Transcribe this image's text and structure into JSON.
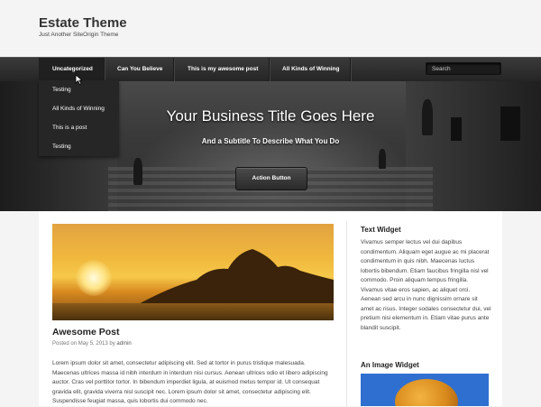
{
  "site": {
    "title": "Estate Theme",
    "tagline": "Just Another SiteOrigin Theme"
  },
  "nav": {
    "items": [
      "Uncategorized",
      "Can You Believe",
      "This is my awesome post",
      "All Kinds of Winning"
    ],
    "search_placeholder": "Search"
  },
  "dropdown": {
    "items": [
      "Testing",
      "All Kinds of Winning",
      "This is a post",
      "Testing"
    ]
  },
  "hero": {
    "title": "Your Business Title Goes Here",
    "subtitle": "And a Subtitle To Describe What You Do",
    "button": "Action Button"
  },
  "post": {
    "title": "Awesome Post",
    "meta_prefix": "Posted on",
    "date": "May 5, 2013",
    "meta_by": "by",
    "author": "admin",
    "excerpt": "Lorem ipsum dolor sit amet, consectetur adipiscing elit. Sed at tortor in purus tristique malesuada. Maecenas ultrices massa id nibh interdum in interdum nisi cursus. Aenean ultrices odio et libero adipiscing auctor. Cras vel porttitor tortor. In bibendum imperdiet ligula, at euismod metus tempor id. Ut consequat gravida elit, gravida viverra nisl suscipit nec. Lorem ipsum dolor sit amet, consectetur adipiscing elit. Suspendisse feugiat massa, quis lobortis dui commodo nec."
  },
  "sidebar": {
    "text_widget_title": "Text Widget",
    "text_widget_body": "Vivamus semper lectus vel dui dapibus condimentum. Aliquam eget augue ac mi placerat condimentum in quis nibh. Maecenas luctus lobortis bibendum. Etiam faucibus fringilla nisl vel commodo. Proin aliquam tempus fringilla. Vivamus vitae eros sapien, ac aliquet orci. Aenean sed arcu in nunc dignissim ornare sit amet ac risus. Integer sodales consectetur dui, vel pretium nisi elementum in. Etiam vitae purus ante blandit suscipit.",
    "image_widget_title": "An Image Widget"
  },
  "colors": {
    "nav_bg": "#2b2b2b",
    "dropdown_bg": "#262626",
    "page_bg": "#f4f4f4"
  }
}
